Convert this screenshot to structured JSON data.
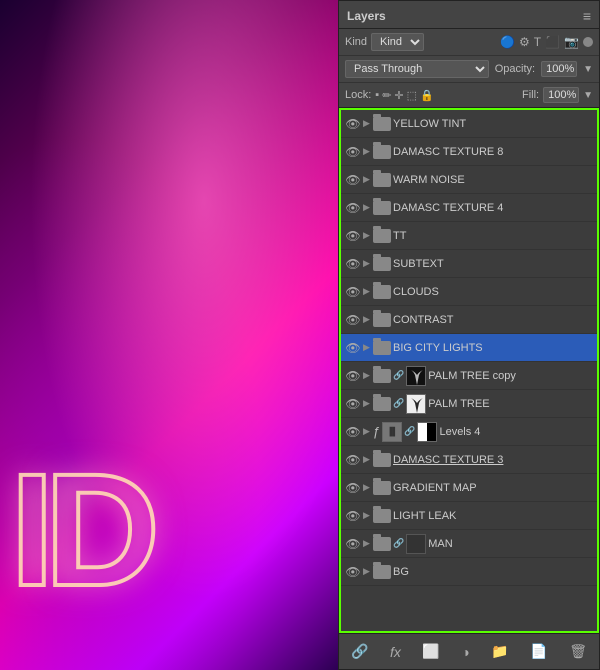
{
  "background": {
    "letters": "ID"
  },
  "panel": {
    "title": "Layers",
    "close_icon": "✕",
    "menu_icon": "≡",
    "kind_label": "Kind",
    "kind_icons": [
      "🔵",
      "T",
      "⬛",
      "📷"
    ],
    "blend_mode": "Pass Through",
    "opacity_label": "Opacity:",
    "opacity_value": "100%",
    "lock_label": "Lock:",
    "fill_label": "Fill:",
    "fill_value": "100%",
    "layers": [
      {
        "name": "YELLOW TINT",
        "type": "folder",
        "visible": true,
        "indent": 0
      },
      {
        "name": "DAMASC TEXTURE 8",
        "type": "folder",
        "visible": true,
        "indent": 0
      },
      {
        "name": "WARM NOISE",
        "type": "folder",
        "visible": true,
        "indent": 0
      },
      {
        "name": "DAMASC TEXTURE 4",
        "type": "folder",
        "visible": true,
        "indent": 0
      },
      {
        "name": "TT",
        "type": "folder",
        "visible": true,
        "indent": 0
      },
      {
        "name": "SUBTEXT",
        "type": "folder",
        "visible": true,
        "indent": 0
      },
      {
        "name": "CLOUDS",
        "type": "folder",
        "visible": true,
        "indent": 0
      },
      {
        "name": "CONTRAST",
        "type": "folder",
        "visible": true,
        "indent": 0
      },
      {
        "name": "BIG CITY LIGHTS",
        "type": "folder",
        "visible": true,
        "indent": 0,
        "selected": true
      },
      {
        "name": "PALM TREE copy",
        "type": "layer-thumb-dark",
        "visible": true,
        "indent": 0,
        "chain": true
      },
      {
        "name": "PALM TREE",
        "type": "layer-thumb-wb",
        "visible": true,
        "indent": 0,
        "chain": true
      },
      {
        "name": "Levels 4",
        "type": "levels",
        "visible": true,
        "indent": 0
      },
      {
        "name": "DAMASC TEXTURE 3",
        "type": "folder",
        "visible": true,
        "indent": 0,
        "underlined": true
      },
      {
        "name": "GRADIENT MAP",
        "type": "folder",
        "visible": true,
        "indent": 0
      },
      {
        "name": "LIGHT LEAK",
        "type": "folder",
        "visible": true,
        "indent": 0
      },
      {
        "name": "MAN",
        "type": "layer-thumb-dark2",
        "visible": true,
        "indent": 0,
        "chain": true
      },
      {
        "name": "BG",
        "type": "folder",
        "visible": true,
        "indent": 0
      }
    ],
    "toolbar_buttons": [
      "link-icon",
      "fx-icon",
      "mask-icon",
      "adjustment-icon",
      "folder-icon",
      "new-layer-icon",
      "delete-icon"
    ]
  }
}
